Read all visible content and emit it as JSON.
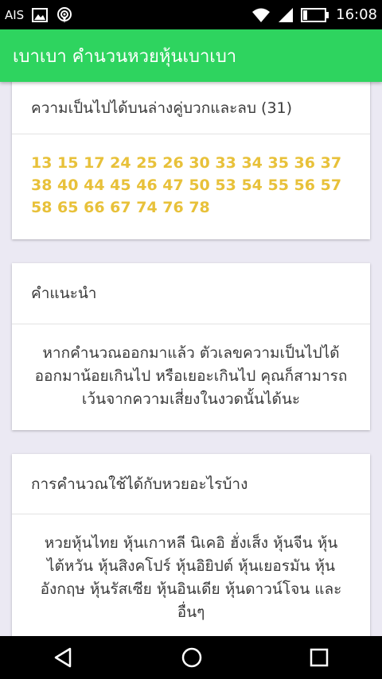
{
  "status_bar": {
    "carrier": "AIS",
    "time": "16:08",
    "icons": [
      "image-icon",
      "hotspot-icon",
      "wifi-icon",
      "signal-icon",
      "battery-icon"
    ]
  },
  "app_bar": {
    "title": "เบาเบา คำนวนหวยหุ้นเบาเบา"
  },
  "cards": {
    "probability": {
      "title": "ความเป็นไปได้บนล่างคู่บวกและลบ (31)",
      "numbers": "13 15 17 24 25 26 30 33 34 35 36 37 38 40 44 45 46 47 50 53 54 55 56 57 58 65 66 67 74 76 78"
    },
    "advice": {
      "title": "คำแนะนำ",
      "body": "หากคำนวณออกมาแล้ว ตัวเลขความเป็นไปได้ ออกมาน้อยเกินไป หรือเยอะเกินไป คุณก็สามารถเว้นจากความเสี่ยงในงวดนั้นได้นะ"
    },
    "usage": {
      "title": "การคำนวณใช้ได้กับหวยอะไรบ้าง",
      "body": "หวยหุ้นไทย หุ้นเกาหลี นิเคอิ ฮั่งเส็ง หุ้นจีน หุ้นไต้หวัน หุ้นสิงคโปร์ หุ้นอิยิปต์ หุ้นเยอรมัน หุ้นอังกฤษ หุ้นรัสเซีย หุ้นอินเดีย หุ้นดาวน์โจน และอื่นๆ"
    }
  },
  "nav_bar": {
    "icons": [
      "back-icon",
      "home-icon",
      "recents-icon"
    ]
  },
  "colors": {
    "app_bar": "#2ed45f",
    "numbers": "#e8c13a",
    "background": "#ebe9f3"
  }
}
